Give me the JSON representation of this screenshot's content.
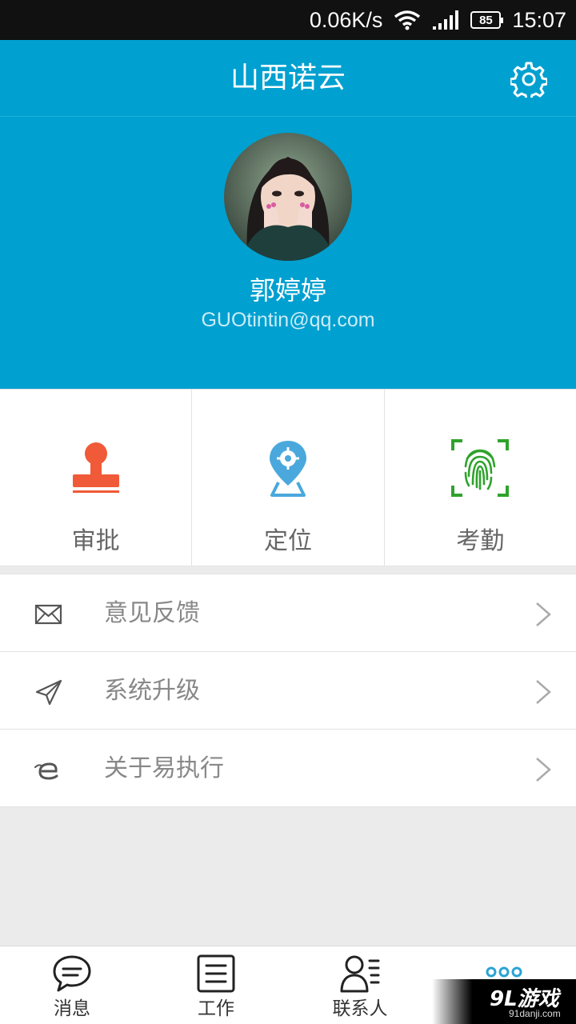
{
  "status_bar": {
    "speed": "0.06K/s",
    "battery": "85",
    "time": "15:07",
    "icons": [
      "wifi-icon",
      "signal-icon",
      "battery-icon"
    ]
  },
  "header": {
    "title": "山西诺云",
    "settings_icon": "gear-icon"
  },
  "profile": {
    "name": "郭婷婷",
    "email": "GUOtintin@qq.com"
  },
  "quick_actions": [
    {
      "label": "审批",
      "icon": "stamp-icon",
      "color": "#f05a38"
    },
    {
      "label": "定位",
      "icon": "location-pin-icon",
      "color": "#4aa8dc"
    },
    {
      "label": "考勤",
      "icon": "fingerprint-icon",
      "color": "#2ea32b"
    }
  ],
  "menu": [
    {
      "label": "意见反馈",
      "icon": "envelope-icon"
    },
    {
      "label": "系统升级",
      "icon": "paper-plane-icon"
    },
    {
      "label": "关于易执行",
      "icon": "e-logo-icon"
    }
  ],
  "tabs": [
    {
      "label": "消息",
      "icon": "chat-bubble-icon"
    },
    {
      "label": "工作",
      "icon": "document-list-icon"
    },
    {
      "label": "联系人",
      "icon": "contacts-icon"
    },
    {
      "label": "",
      "icon": "more-dots-icon",
      "active": true
    }
  ],
  "watermark": {
    "main": "9L游戏",
    "sub": "91danji.com"
  },
  "colors": {
    "primary": "#00a0d0",
    "active_tab": "#29a3d6",
    "background": "#ebebeb"
  }
}
